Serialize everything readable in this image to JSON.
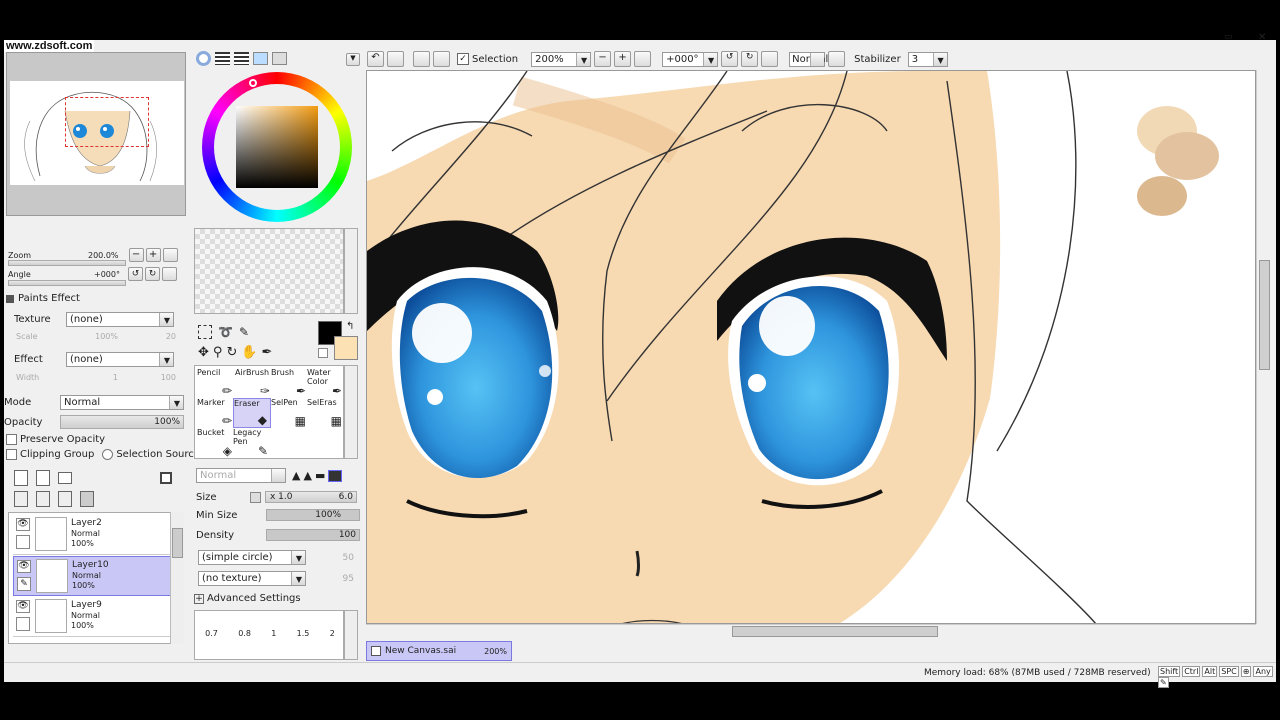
{
  "watermark": "www.zdsoft.com",
  "toolbar": {
    "selection_label": "Selection",
    "zoom_value": "200%",
    "angle_value": "+000°",
    "blend_value": "Normal",
    "stabilizer_label": "Stabilizer",
    "stabilizer_value": "3"
  },
  "navigator": {
    "zoom_label": "Zoom",
    "zoom_value": "200.0%",
    "angle_label": "Angle",
    "angle_value": "+000°"
  },
  "paint_effect": {
    "title": "Paints Effect",
    "texture_label": "Texture",
    "texture_value": "(none)",
    "scale_label": "Scale",
    "scale_value": "100%",
    "scale_num": "20",
    "effect_label": "Effect",
    "effect_value": "(none)",
    "width_label": "Width",
    "width_num": "1",
    "width_max": "100"
  },
  "layer_props": {
    "mode_label": "Mode",
    "mode_value": "Normal",
    "opacity_label": "Opacity",
    "opacity_value": "100%",
    "preserve_opacity": "Preserve Opacity",
    "clipping_group": "Clipping Group",
    "selection_source": "Selection Source"
  },
  "layers": [
    {
      "name": "Layer2",
      "mode": "Normal",
      "opacity": "100%"
    },
    {
      "name": "Layer10",
      "mode": "Normal",
      "opacity": "100%"
    },
    {
      "name": "Layer9",
      "mode": "Normal",
      "opacity": "100%"
    }
  ],
  "tools": [
    {
      "label": "Pencil"
    },
    {
      "label": "AirBrush"
    },
    {
      "label": "Brush"
    },
    {
      "label": "Water Color"
    },
    {
      "label": "Marker"
    },
    {
      "label": "Eraser"
    },
    {
      "label": "SelPen"
    },
    {
      "label": "SelEras"
    },
    {
      "label": "Bucket"
    },
    {
      "label": "Legacy Pen"
    }
  ],
  "brush": {
    "blend": "Normal",
    "size_label": "Size",
    "size_mult": "x 1.0",
    "size_value": "6.0",
    "min_size_label": "Min Size",
    "min_size_value": "100%",
    "density_label": "Density",
    "density_value": "100",
    "shape_value": "(simple circle)",
    "shape_num": "50",
    "texture_value": "(no texture)",
    "texture_num": "95",
    "advanced": "Advanced Settings",
    "presets": [
      "0.7",
      "0.8",
      "1",
      "1.5",
      "2"
    ]
  },
  "canvas_tab": {
    "name": "New Canvas.sai",
    "zoom": "200%"
  },
  "status": {
    "memory": "Memory load: 68% (87MB used / 728MB reserved)",
    "keys": [
      "Shift",
      "Ctrl",
      "Alt",
      "SPC",
      "⊕",
      "Any",
      "✎"
    ]
  },
  "colors": {
    "skin": "#f7d9b2",
    "iris": "#2e95dd",
    "selection_highlight": "#c9c7f5"
  }
}
